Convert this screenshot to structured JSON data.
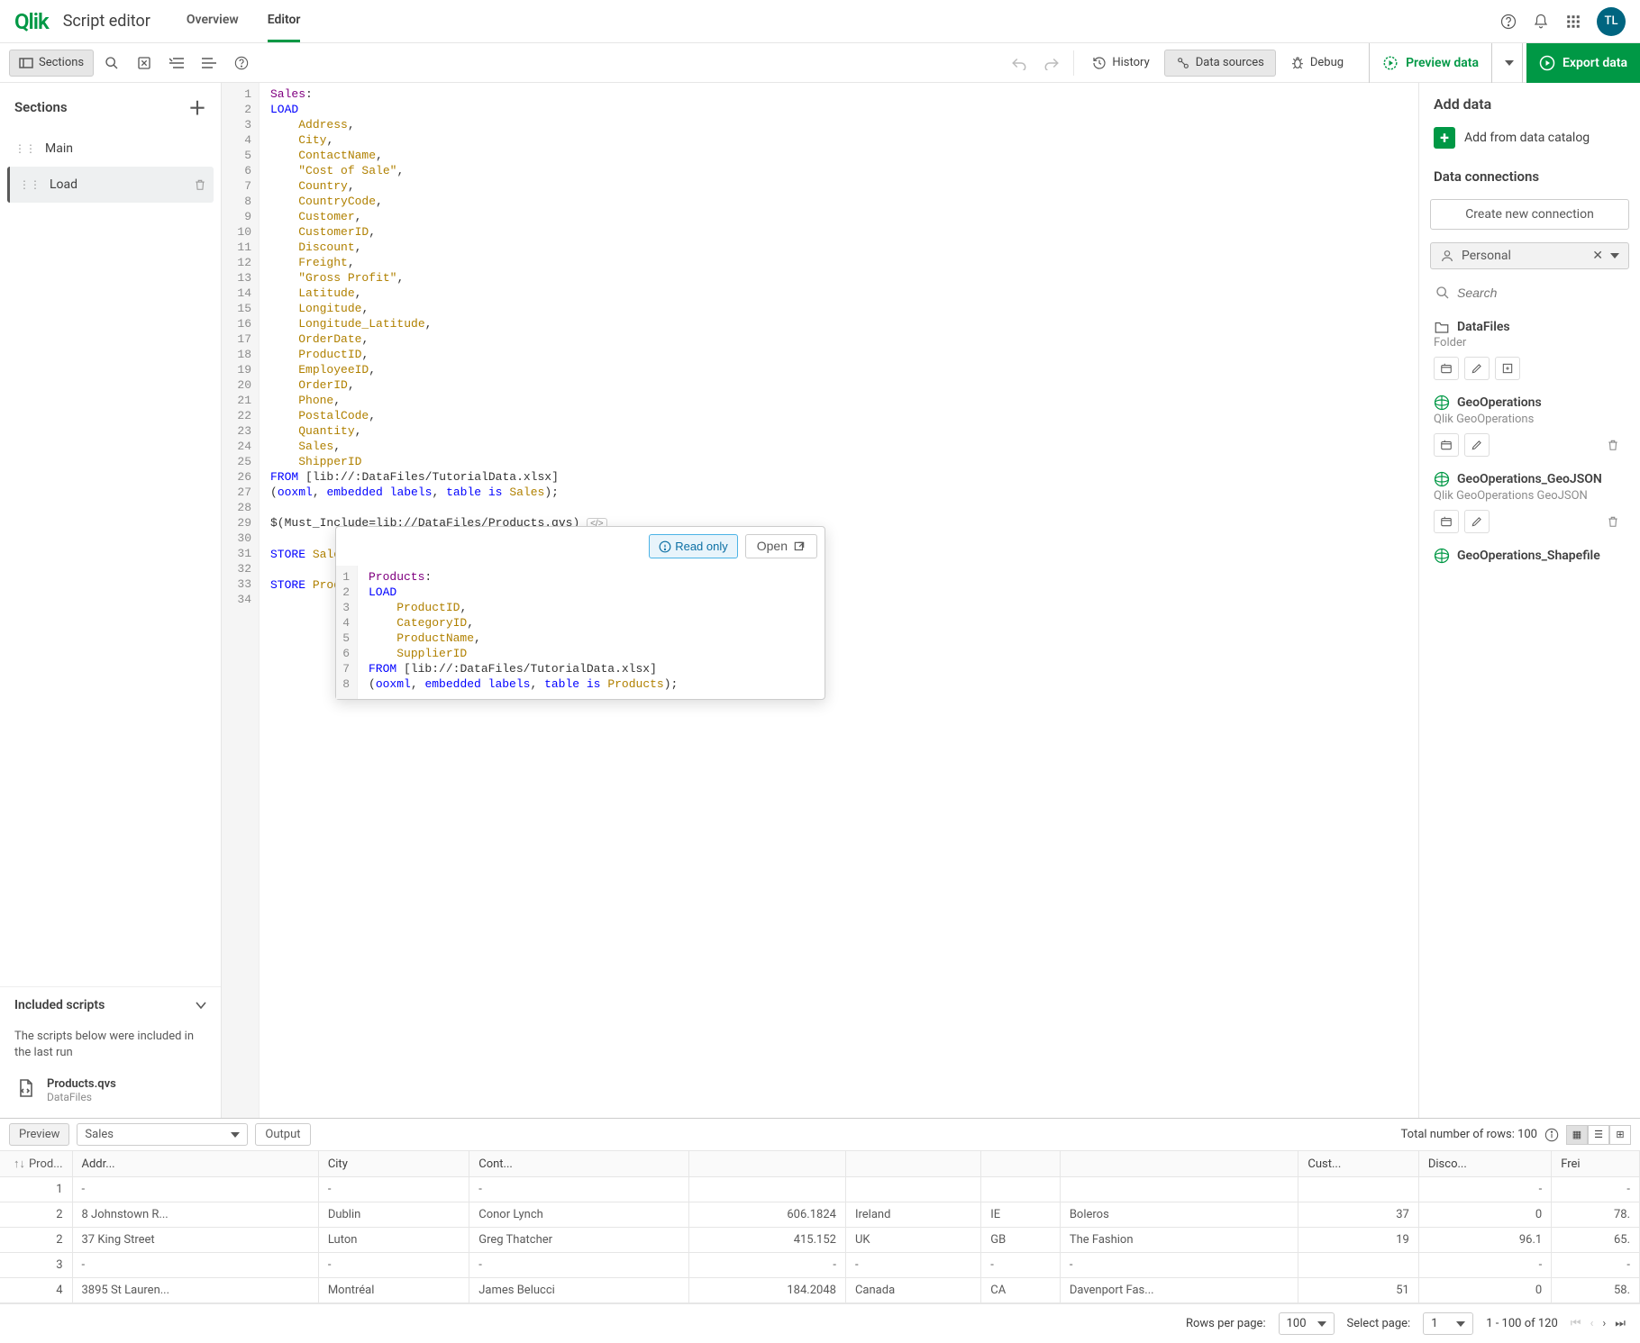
{
  "header": {
    "logo": "Qlik",
    "app_title": "Script editor",
    "tabs": {
      "overview": "Overview",
      "editor": "Editor"
    },
    "avatar": "TL"
  },
  "toolbar": {
    "sections": "Sections",
    "history": "History",
    "data_sources": "Data sources",
    "debug": "Debug",
    "preview": "Preview data",
    "export": "Export data"
  },
  "sidebar": {
    "header": "Sections",
    "items": [
      {
        "label": "Main"
      },
      {
        "label": "Load"
      }
    ],
    "included_header": "Included scripts",
    "included_note": "The scripts below were included in the last run",
    "included_file": {
      "name": "Products.qvs",
      "location": "DataFiles"
    }
  },
  "editor": {
    "lines": [
      {
        "n": 1,
        "html": "<span class='kw-purple'>Sales</span><span class='kw-dark'>:</span>"
      },
      {
        "n": 2,
        "html": "<span class='kw-blue'>LOAD</span>"
      },
      {
        "n": 3,
        "html": "    <span class='kw-field'>Address</span><span class='kw-dark'>,</span>"
      },
      {
        "n": 4,
        "html": "    <span class='kw-field'>City</span><span class='kw-dark'>,</span>"
      },
      {
        "n": 5,
        "html": "    <span class='kw-field'>ContactName</span><span class='kw-dark'>,</span>"
      },
      {
        "n": 6,
        "html": "    <span class='kw-field'>\"Cost of Sale\"</span><span class='kw-dark'>,</span>"
      },
      {
        "n": 7,
        "html": "    <span class='kw-field'>Country</span><span class='kw-dark'>,</span>"
      },
      {
        "n": 8,
        "html": "    <span class='kw-field'>CountryCode</span><span class='kw-dark'>,</span>"
      },
      {
        "n": 9,
        "html": "    <span class='kw-field'>Customer</span><span class='kw-dark'>,</span>"
      },
      {
        "n": 10,
        "html": "    <span class='kw-field'>CustomerID</span><span class='kw-dark'>,</span>"
      },
      {
        "n": 11,
        "html": "    <span class='kw-field'>Discount</span><span class='kw-dark'>,</span>"
      },
      {
        "n": 12,
        "html": "    <span class='kw-field'>Freight</span><span class='kw-dark'>,</span>"
      },
      {
        "n": 13,
        "html": "    <span class='kw-field'>\"Gross Profit\"</span><span class='kw-dark'>,</span>"
      },
      {
        "n": 14,
        "html": "    <span class='kw-field'>Latitude</span><span class='kw-dark'>,</span>"
      },
      {
        "n": 15,
        "html": "    <span class='kw-field'>Longitude</span><span class='kw-dark'>,</span>"
      },
      {
        "n": 16,
        "html": "    <span class='kw-field'>Longitude_Latitude</span><span class='kw-dark'>,</span>"
      },
      {
        "n": 17,
        "html": "    <span class='kw-field'>OrderDate</span><span class='kw-dark'>,</span>"
      },
      {
        "n": 18,
        "html": "    <span class='kw-field'>ProductID</span><span class='kw-dark'>,</span>"
      },
      {
        "n": 19,
        "html": "    <span class='kw-field'>EmployeeID</span><span class='kw-dark'>,</span>"
      },
      {
        "n": 20,
        "html": "    <span class='kw-field'>OrderID</span><span class='kw-dark'>,</span>"
      },
      {
        "n": 21,
        "html": "    <span class='kw-field'>Phone</span><span class='kw-dark'>,</span>"
      },
      {
        "n": 22,
        "html": "    <span class='kw-field'>PostalCode</span><span class='kw-dark'>,</span>"
      },
      {
        "n": 23,
        "html": "    <span class='kw-field'>Quantity</span><span class='kw-dark'>,</span>"
      },
      {
        "n": 24,
        "html": "    <span class='kw-field'>Sales</span><span class='kw-dark'>,</span>"
      },
      {
        "n": 25,
        "html": "    <span class='kw-field'>ShipperID</span>"
      },
      {
        "n": 26,
        "html": "<span class='kw-blue'>FROM</span> <span class='kw-dark'>[lib://:DataFiles/TutorialData.xlsx]</span>"
      },
      {
        "n": 27,
        "html": "<span class='kw-dark'>(</span><span class='kw-blue'>ooxml</span><span class='kw-dark'>, </span><span class='kw-blue'>embedded labels</span><span class='kw-dark'>, </span><span class='kw-blue'>table is</span> <span class='kw-field'>Sales</span><span class='kw-dark'>);</span>"
      },
      {
        "n": 28,
        "html": ""
      },
      {
        "n": 29,
        "html": "<span class='kw-dark'>$(Must_Include=lib://DataFiles/Products.qvs)</span> <span style='border:1px solid #ccc;border-radius:3px;padding:0 3px;font-family:sans-serif;font-size:10px;color:#888'>&lt;/&gt;</span>"
      },
      {
        "n": 30,
        "html": ""
      },
      {
        "n": 31,
        "html": "<span class='kw-blue'>STORE</span> <span class='kw-field'>Sale</span>"
      },
      {
        "n": 32,
        "html": ""
      },
      {
        "n": 33,
        "html": "<span class='kw-blue'>STORE</span> <span class='kw-field'>Prod</span>"
      },
      {
        "n": 34,
        "html": ""
      }
    ]
  },
  "popup": {
    "readonly": "Read only",
    "open": "Open",
    "lines": [
      {
        "n": 1,
        "html": "<span class='kw-purple'>Products</span><span class='kw-dark'>:</span>"
      },
      {
        "n": 2,
        "html": "<span class='kw-blue'>LOAD</span>"
      },
      {
        "n": 3,
        "html": "    <span class='kw-field'>ProductID</span><span class='kw-dark'>,</span>"
      },
      {
        "n": 4,
        "html": "    <span class='kw-field'>CategoryID</span><span class='kw-dark'>,</span>"
      },
      {
        "n": 5,
        "html": "    <span class='kw-field'>ProductName</span><span class='kw-dark'>,</span>"
      },
      {
        "n": 6,
        "html": "    <span class='kw-field'>SupplierID</span>"
      },
      {
        "n": 7,
        "html": "<span class='kw-blue'>FROM</span> <span class='kw-dark'>[lib://:DataFiles/TutorialData.xlsx]</span>"
      },
      {
        "n": 8,
        "html": "<span class='kw-dark'>(</span><span class='kw-blue'>ooxml</span><span class='kw-dark'>, </span><span class='kw-blue'>embedded labels</span><span class='kw-dark'>, </span><span class='kw-blue'>table is</span> <span class='kw-field'>Products</span><span class='kw-dark'>);</span>"
      }
    ]
  },
  "right": {
    "add_data": "Add data",
    "add_catalog": "Add from data catalog",
    "data_connections": "Data connections",
    "create_conn": "Create new connection",
    "personal": "Personal",
    "search_placeholder": "Search",
    "conns": [
      {
        "title": "DataFiles",
        "sub": "Folder",
        "icon": "folder"
      },
      {
        "title": "GeoOperations",
        "sub": "Qlik GeoOperations",
        "icon": "globe"
      },
      {
        "title": "GeoOperations_GeoJSON",
        "sub": "Qlik GeoOperations GeoJSON",
        "icon": "globe"
      },
      {
        "title": "GeoOperations_Shapefile",
        "sub": "",
        "icon": "globe"
      }
    ]
  },
  "preview": {
    "preview_btn": "Preview",
    "table_select": "Sales",
    "output_btn": "Output",
    "total_rows": "Total number of rows: 100",
    "columns": [
      "Prod...",
      "Addr...",
      "City",
      "Cont...",
      "",
      "",
      "",
      "",
      "Cust...",
      "Disco...",
      "Frei"
    ],
    "rows": [
      [
        "1",
        "-",
        "-",
        "-",
        "",
        "",
        "",
        "",
        "",
        "-",
        "-"
      ],
      [
        "2",
        "8 Johnstown R...",
        "Dublin",
        "Conor Lynch",
        "606.1824",
        "Ireland",
        "IE",
        "Boleros",
        "37",
        "0",
        "78."
      ],
      [
        "2",
        "37 King Street",
        "Luton",
        "Greg Thatcher",
        "415.152",
        "UK",
        "GB",
        "The Fashion",
        "19",
        "96.1",
        "65."
      ],
      [
        "3",
        "-",
        "-",
        "-",
        "-",
        "-",
        "-",
        "-",
        "",
        "-",
        "-"
      ],
      [
        "4",
        "3895 St Lauren...",
        "Montréal",
        "James Belucci",
        "184.2048",
        "Canada",
        "CA",
        "Davenport Fas...",
        "51",
        "0",
        "58."
      ]
    ]
  },
  "pager": {
    "rows_per_page": "Rows per page:",
    "rows_value": "100",
    "select_page": "Select page:",
    "page_value": "1",
    "range": "1 - 100 of 120"
  }
}
